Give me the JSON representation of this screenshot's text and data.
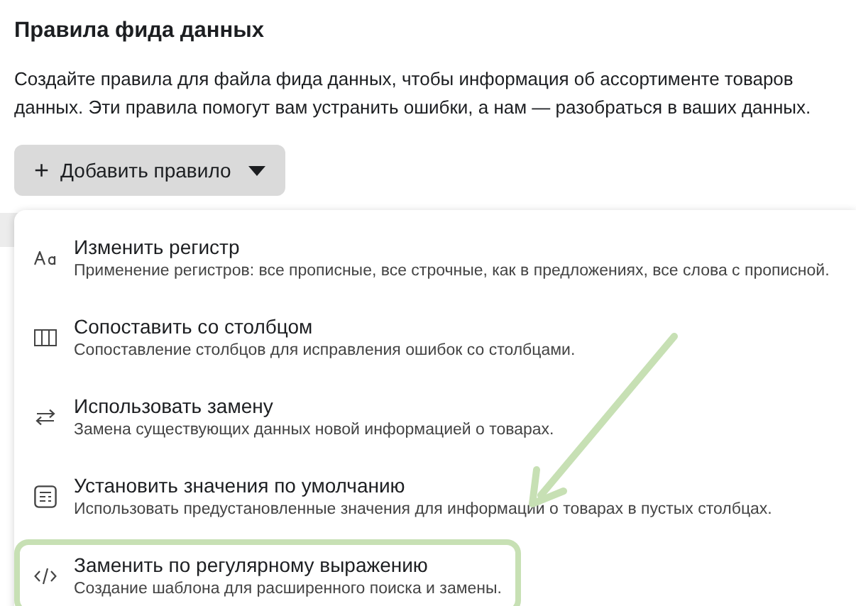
{
  "title": "Правила фида данных",
  "description_lines": [
    "Создайте правила для файла фида данных, чтобы информация об ассортименте товаров",
    "данных. Эти правила помогут вам устранить ошибки, а нам — разобраться в ваших данных."
  ],
  "add_button": {
    "icon": "+",
    "label": "Добавить правило"
  },
  "menu_items": [
    {
      "kind": "case",
      "title": "Изменить регистр",
      "description": "Применение регистров: все прописные, все строчные, как в предложениях, все слова с прописной.",
      "highlighted": false
    },
    {
      "kind": "columns",
      "title": "Сопоставить со столбцом",
      "description": "Сопоставление столбцов для исправления ошибок со столбцами.",
      "highlighted": false
    },
    {
      "kind": "replace",
      "title": "Использовать замену",
      "description": "Замена существующих данных новой информацией о товарах.",
      "highlighted": false
    },
    {
      "kind": "defaults",
      "title": "Установить значения по умолчанию",
      "description": "Использовать предустановленные значения для информации о товарах в пустых столбцах.",
      "highlighted": false
    },
    {
      "kind": "regex",
      "title": "Заменить по регулярному выражению",
      "description": "Создание шаблона для расширенного поиска и замены.",
      "highlighted": true
    }
  ]
}
